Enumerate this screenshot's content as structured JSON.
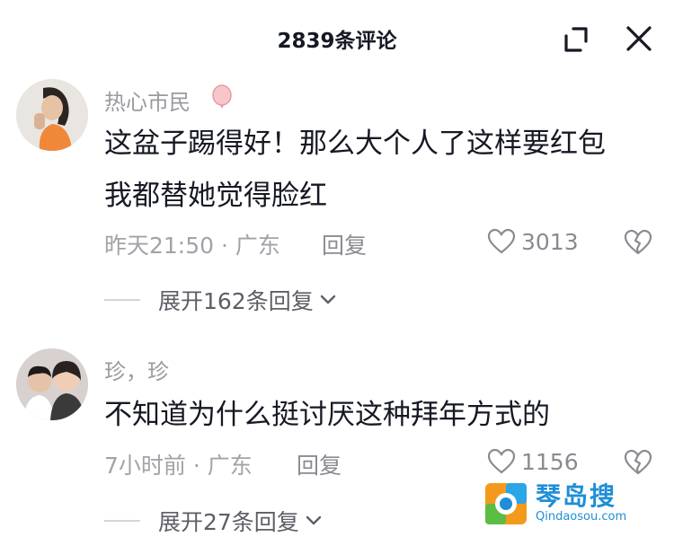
{
  "header": {
    "title": "2839条评论"
  },
  "comments": [
    {
      "username": "热心市民",
      "text_lines": [
        "这盆子踢得好！那么大个人了这样要红包",
        "我都替她觉得脸红"
      ],
      "meta": "昨天21:50 · 广东",
      "reply_label": "回复",
      "likes": "3013",
      "expand_label": "展开162条回复"
    },
    {
      "username": "珍，珍",
      "text_lines": [
        "不知道为什么挺讨厌这种拜年方式的"
      ],
      "meta": "7小时前 · 广东",
      "reply_label": "回复",
      "likes": "1156",
      "expand_label": "展开27条回复"
    }
  ],
  "watermark": {
    "name": "琴岛搜",
    "url": "Qindaosou.com"
  },
  "colors": {
    "text": "#161823",
    "muted": "#a2a3a8",
    "accent": "#1f8ed6"
  }
}
